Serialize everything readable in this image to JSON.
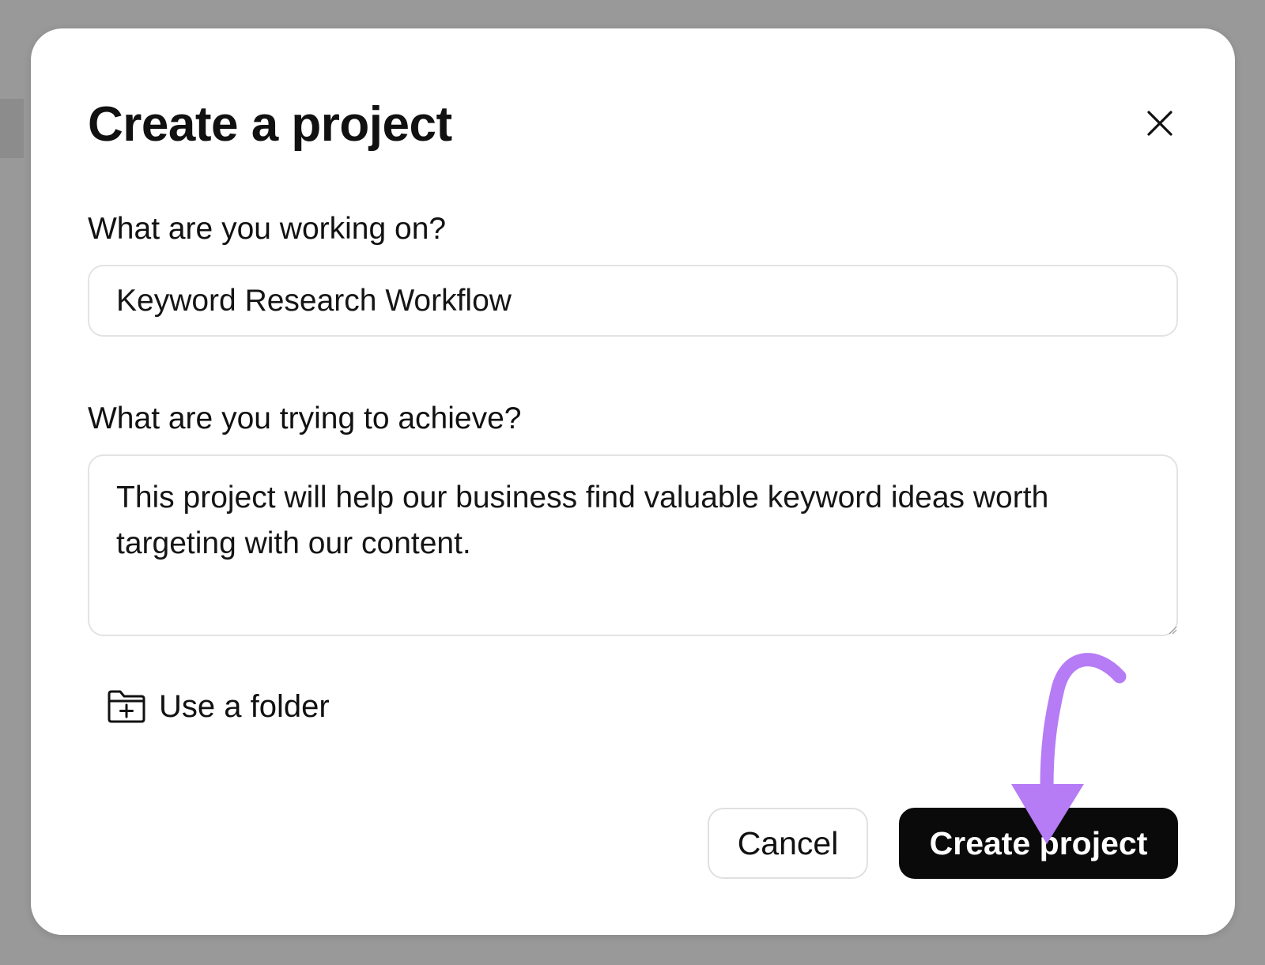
{
  "dialog": {
    "title": "Create a project",
    "close_icon": "close-icon"
  },
  "project_name": {
    "label": "What are you working on?",
    "value": "Keyword Research Workflow"
  },
  "project_goal": {
    "label": "What are you trying to achieve?",
    "value": "This project will help our business find valuable keyword ideas worth targeting with our content."
  },
  "folder": {
    "icon": "folder-plus-icon",
    "label": "Use a folder"
  },
  "actions": {
    "cancel_label": "Cancel",
    "create_label": "Create project"
  },
  "colors": {
    "backdrop": "#999999",
    "dialog_background": "#ffffff",
    "primary_button": "#0a0a0a",
    "annotation_arrow": "#b57cf6"
  }
}
